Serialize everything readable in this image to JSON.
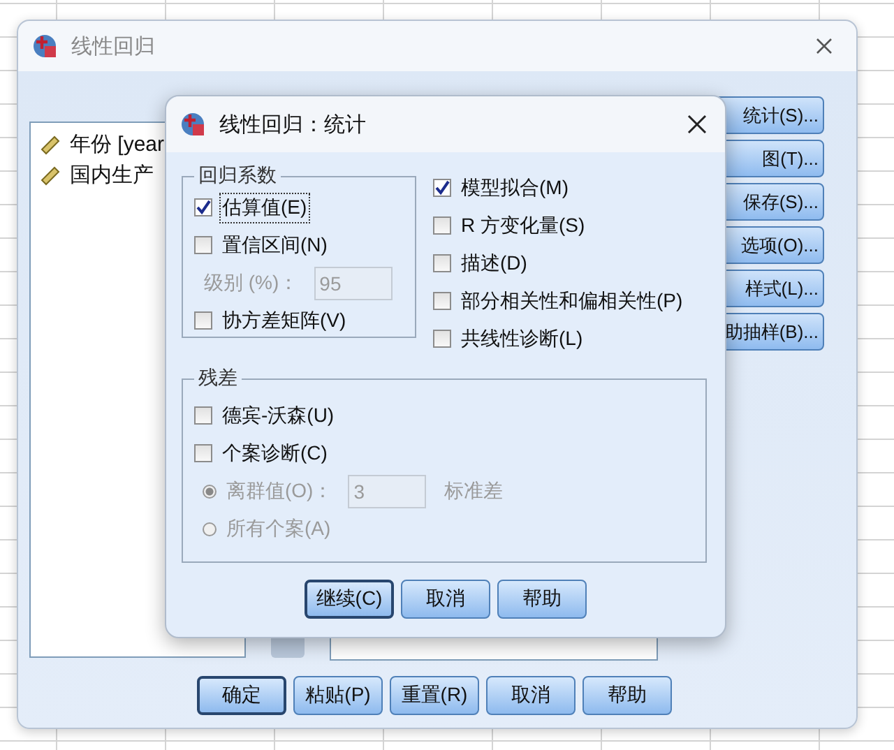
{
  "main_window": {
    "title": "线性回归",
    "variables": [
      {
        "label": "年份 [year"
      },
      {
        "label": "国内生产"
      }
    ],
    "side_buttons": [
      {
        "label": "统计(S)..."
      },
      {
        "label": "图(T)..."
      },
      {
        "label": "保存(S)..."
      },
      {
        "label": "选项(O)..."
      },
      {
        "label": "样式(L)..."
      },
      {
        "label": "助抽样(B)..."
      }
    ],
    "buttons": [
      {
        "label": "确定",
        "default": true
      },
      {
        "label": "粘贴(P)",
        "default": false
      },
      {
        "label": "重置(R)",
        "default": false
      },
      {
        "label": "取消",
        "default": false
      },
      {
        "label": "帮助",
        "default": false
      }
    ]
  },
  "dialog": {
    "title": "线性回归：统计",
    "coefficients": {
      "title": "回归系数",
      "options": [
        {
          "kind": "checkbox",
          "label": "估算值(E)",
          "checked": true,
          "focused": true
        },
        {
          "kind": "checkbox",
          "label": "置信区间(N)",
          "checked": false,
          "focused": false
        },
        {
          "kind": "field",
          "label": "级别 (%)：",
          "value": "95",
          "disabled": true
        },
        {
          "kind": "checkbox",
          "label": "协方差矩阵(V)",
          "checked": false,
          "focused": false
        }
      ]
    },
    "model_options": [
      {
        "kind": "checkbox",
        "label": "模型拟合(M)",
        "checked": true,
        "focused": false
      },
      {
        "kind": "checkbox",
        "label": "R 方变化量(S)",
        "checked": false,
        "focused": false
      },
      {
        "kind": "checkbox",
        "label": "描述(D)",
        "checked": false,
        "focused": false
      },
      {
        "kind": "checkbox",
        "label": "部分相关性和偏相关性(P)",
        "checked": false,
        "focused": false
      },
      {
        "kind": "checkbox",
        "label": "共线性诊断(L)",
        "checked": false,
        "focused": false
      }
    ],
    "residuals": {
      "title": "残差",
      "options": [
        {
          "kind": "checkbox",
          "label": "德宾-沃森(U)",
          "checked": false,
          "focused": false
        },
        {
          "kind": "checkbox",
          "label": "个案诊断(C)",
          "checked": false,
          "focused": false
        },
        {
          "kind": "radio",
          "label": "离群值(O)：",
          "value": "3",
          "unit": "标准差",
          "selected": true,
          "disabled": true
        },
        {
          "kind": "radio",
          "label": "所有个案(A)",
          "selected": false,
          "disabled": true
        }
      ]
    },
    "buttons": [
      {
        "label": "继续(C)",
        "default": true
      },
      {
        "label": "取消",
        "default": false
      },
      {
        "label": "帮助",
        "default": false
      }
    ]
  }
}
